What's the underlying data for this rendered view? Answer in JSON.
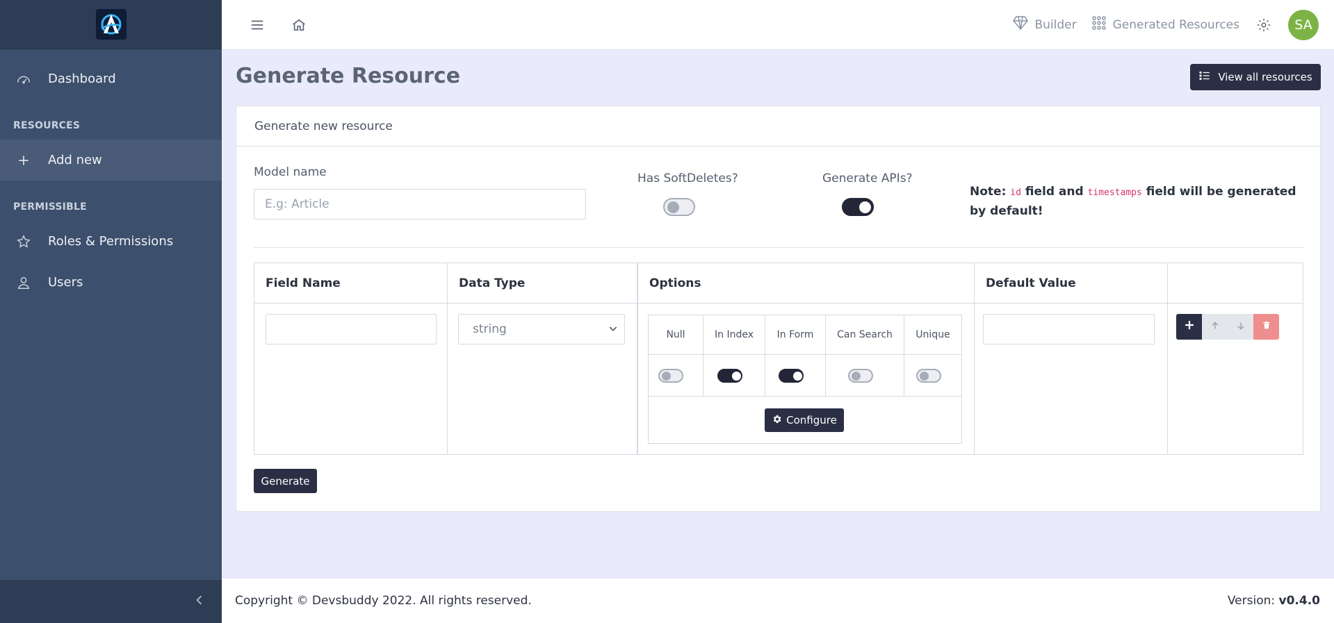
{
  "sidebar": {
    "logo": "app-logo",
    "dashboard": "Dashboard",
    "section_resources": "RESOURCES",
    "add_new": "Add new",
    "section_permissible": "PERMISSIBLE",
    "roles": "Roles & Permissions",
    "users": "Users"
  },
  "header": {
    "builder": "Builder",
    "generated_resources": "Generated Resources",
    "avatar": "SA"
  },
  "page": {
    "title": "Generate Resource",
    "view_all": "View all resources"
  },
  "card": {
    "head": "Generate new resource",
    "model_name_label": "Model name",
    "model_name_placeholder": "E.g: Article",
    "softdeletes_label": "Has SoftDeletes?",
    "softdeletes_on": false,
    "apis_label": "Generate APIs?",
    "apis_on": true,
    "note_prefix": "Note: ",
    "note_code1": "id",
    "note_mid": " field and ",
    "note_code2": "timestamps",
    "note_suffix": " field will be generated by default!"
  },
  "table": {
    "headers": [
      "Field Name",
      "Data Type",
      "Options",
      "Default Value"
    ],
    "row": {
      "field_name": "",
      "data_type": "string",
      "default_value": ""
    },
    "options": {
      "headers": [
        "Null",
        "In Index",
        "In Form",
        "Can Search",
        "Unique"
      ],
      "values": [
        false,
        true,
        true,
        false,
        false
      ],
      "configure": "Configure"
    }
  },
  "generate_button": "Generate",
  "footer": {
    "copyright": "Copyright © Devsbuddy 2022. All rights reserved.",
    "version_label": "Version: ",
    "version": "v0.4.0"
  },
  "colors": {
    "sidebar": "#3c4f6c",
    "accent_dark": "#2b2f45",
    "avatar": "#7db345",
    "delete": "#ef8e8e",
    "code": "#d6336c"
  }
}
